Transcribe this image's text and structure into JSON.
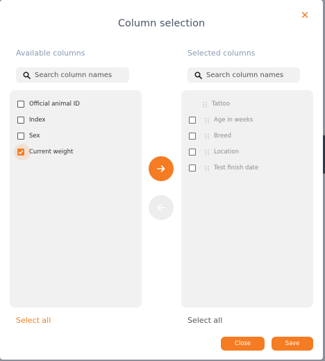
{
  "dialog": {
    "title": "Column selection",
    "close_icon": "close-icon"
  },
  "available": {
    "heading": "Available columns",
    "search_placeholder": "Search column names",
    "items": [
      {
        "label": "Official animal ID",
        "checked": false
      },
      {
        "label": "Index",
        "checked": false
      },
      {
        "label": "Sex",
        "checked": false
      },
      {
        "label": "Current weight",
        "checked": true
      }
    ],
    "select_all": "Select all"
  },
  "selected": {
    "heading": "Selected columns",
    "search_placeholder": "Search column names",
    "items": [
      {
        "label": "Tattoo",
        "has_checkbox": false
      },
      {
        "label": "Age in weeks",
        "has_checkbox": true
      },
      {
        "label": "Breed",
        "has_checkbox": true
      },
      {
        "label": "Location",
        "has_checkbox": true
      },
      {
        "label": "Test finish date",
        "has_checkbox": true
      }
    ],
    "select_all": "Select all"
  },
  "transfer": {
    "move_right_icon": "arrow-right-icon",
    "move_left_icon": "arrow-left-icon",
    "move_left_enabled": false
  },
  "footer": {
    "close_label": "Close",
    "save_label": "Save"
  },
  "colors": {
    "accent": "#f57c22",
    "heading": "#8a9bb0",
    "panel": "#f1f1f1"
  }
}
